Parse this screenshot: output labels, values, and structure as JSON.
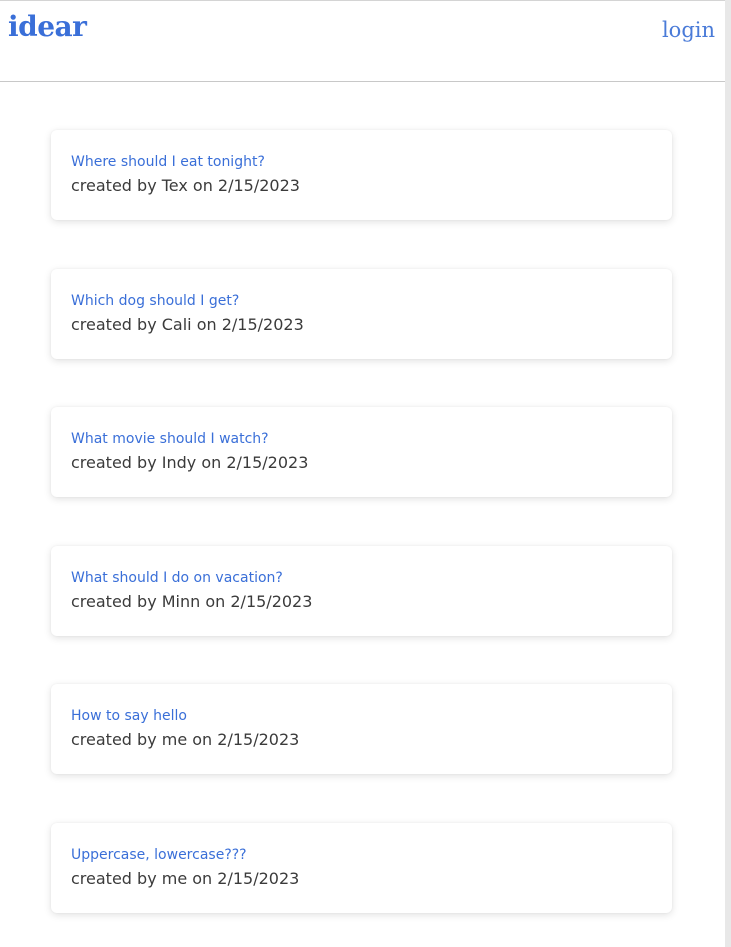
{
  "header": {
    "logo": "idear",
    "login_label": "login"
  },
  "posts": [
    {
      "title": "Where should I eat tonight?",
      "byline": "created by Tex on 2/15/2023"
    },
    {
      "title": "Which dog should I get?",
      "byline": "created by Cali on 2/15/2023"
    },
    {
      "title": "What movie should I watch?",
      "byline": "created by Indy on 2/15/2023"
    },
    {
      "title": "What should I do on vacation?",
      "byline": "created by Minn on 2/15/2023"
    },
    {
      "title": "How to say hello",
      "byline": "created by me on 2/15/2023"
    },
    {
      "title": "Uppercase, lowercase???",
      "byline": "created by me on 2/15/2023"
    }
  ],
  "colors": {
    "accent": "#3a6fd8",
    "text": "#3b3b3b"
  }
}
